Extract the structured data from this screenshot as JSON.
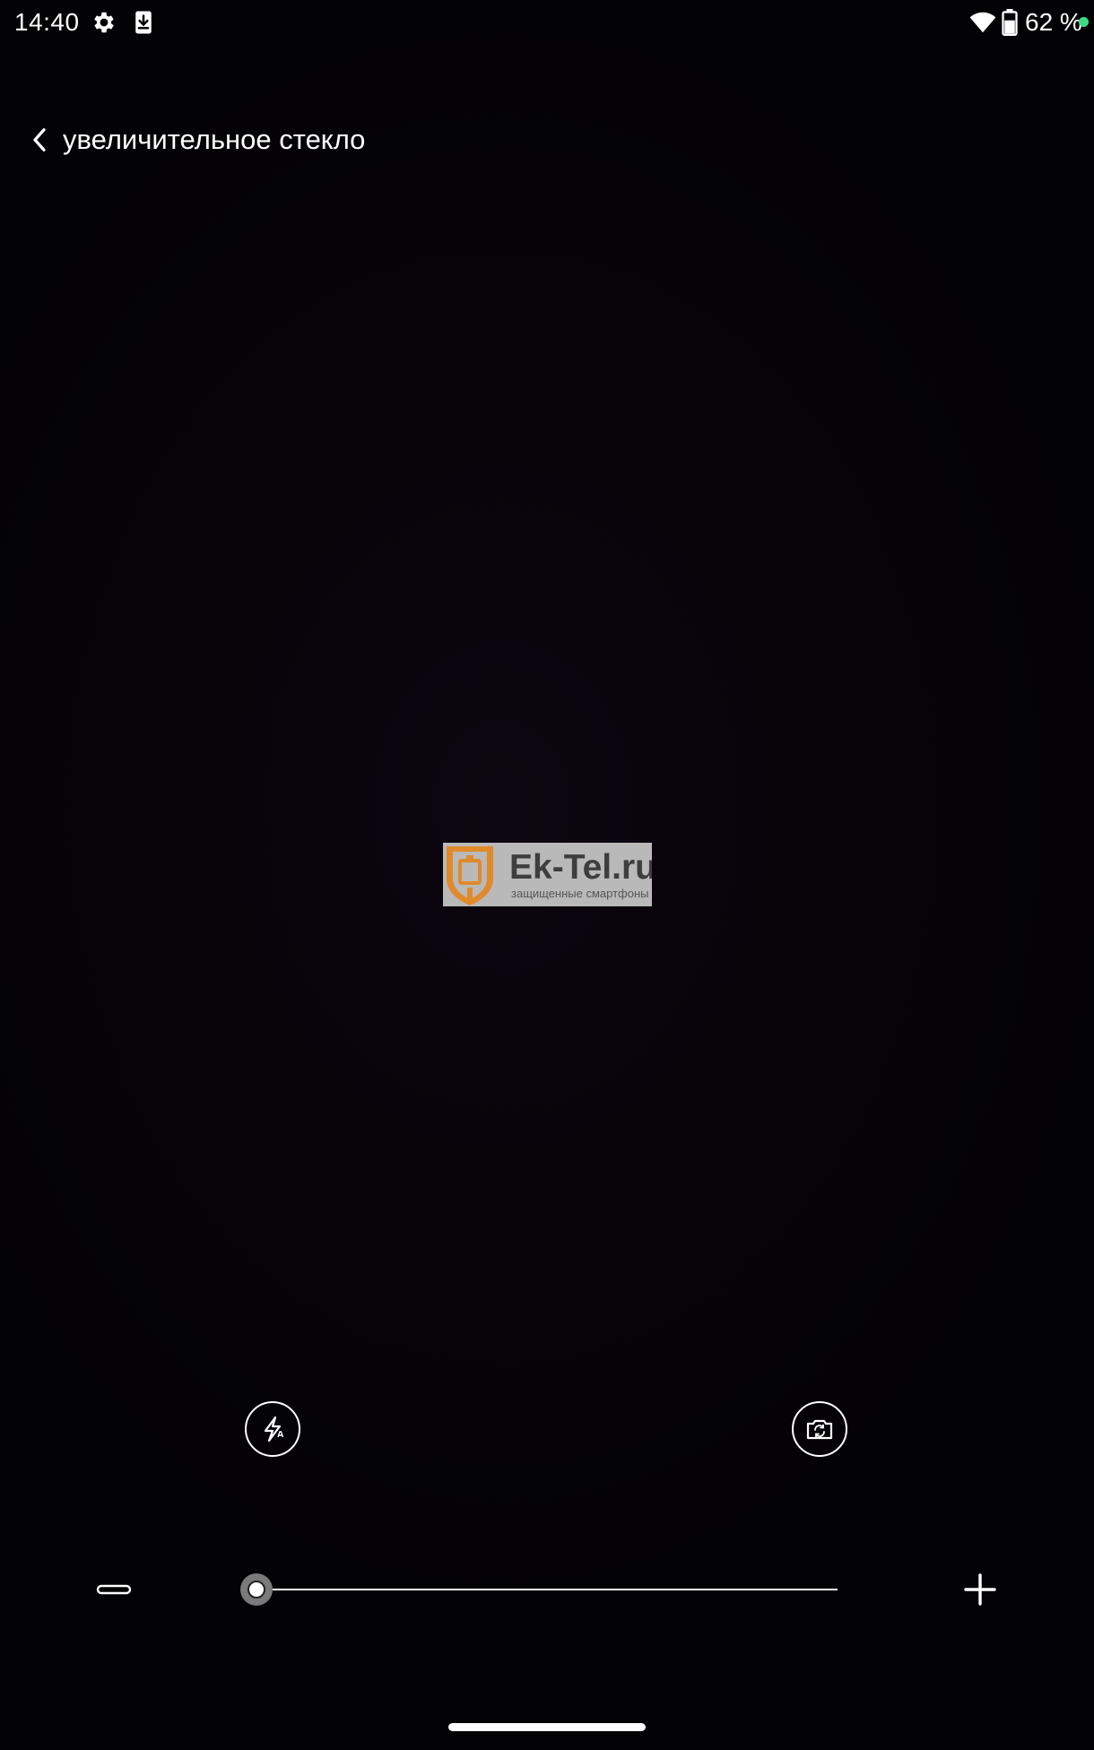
{
  "status_bar": {
    "time": "14:40",
    "icons": {
      "settings": "gear-icon",
      "download": "download-icon",
      "wifi": "wifi-icon",
      "battery": "battery-icon"
    },
    "battery_text": "62 %",
    "notification_dot_color": "#3ddc84"
  },
  "header": {
    "back_icon": "chevron-left-icon",
    "title": "увеличительное стекло"
  },
  "watermark": {
    "brand": "Ek-Tel.ru",
    "tagline": "защищенные смартфоны",
    "accent_color": "#e08a2c"
  },
  "controls": {
    "flash_icon": "flash-auto-icon",
    "switch_camera_icon": "switch-camera-icon"
  },
  "zoom": {
    "minus_icon": "minus-icon",
    "plus_icon": "plus-icon",
    "level": 0
  },
  "colors": {
    "background": "#050206",
    "foreground": "#ffffff"
  }
}
